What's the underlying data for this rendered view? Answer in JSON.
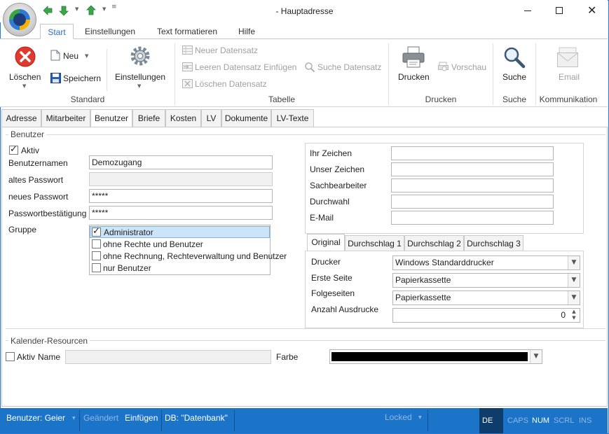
{
  "window": {
    "title": "- Hauptadresse"
  },
  "ribbon": {
    "tabs": [
      "Start",
      "Einstellungen",
      "Text formatieren",
      "Hilfe"
    ],
    "standard": {
      "group_label": "Standard",
      "delete_label": "Löschen",
      "new_label": "Neu",
      "save_label": "Speichern",
      "settings_label": "Einstellungen"
    },
    "tabelle": {
      "group_label": "Tabelle",
      "new_record": "Neuer Datensatz",
      "insert_empty": "Leeren Datensatz Einfügen",
      "search_record": "Suche Datensatz",
      "delete_record": "Löschen Datensatz"
    },
    "drucken": {
      "group_label": "Drucken",
      "print_label": "Drucken",
      "preview_label": "Vorschau"
    },
    "suche": {
      "group_label": "Suche",
      "search_label": "Suche"
    },
    "kommunikation": {
      "group_label": "Kommunikation",
      "email_label": "Email"
    }
  },
  "page_tabs": [
    "Adresse",
    "Mitarbeiter",
    "Benutzer",
    "Briefe",
    "Kosten",
    "LV",
    "Dokumente",
    "LV-Texte"
  ],
  "benutzer": {
    "group_title": "Benutzer",
    "aktiv_label": "Aktiv",
    "aktiv_checked": true,
    "username_label": "Benutzernamen",
    "username_value": "Demozugang",
    "old_pw_label": "altes Passwort",
    "old_pw_value": "",
    "new_pw_label": "neues Passwort",
    "new_pw_value": "*****",
    "confirm_pw_label": "Passwortbestätigung",
    "confirm_pw_value": "*****",
    "group_label": "Gruppe",
    "groups": [
      {
        "label": "Administrator",
        "checked": true
      },
      {
        "label": "ohne Rechte und Benutzer",
        "checked": false
      },
      {
        "label": "ohne Rechnung, Rechteverwaltung und Benutzer",
        "checked": false
      },
      {
        "label": "nur Benutzer",
        "checked": false
      }
    ]
  },
  "reference": {
    "ihr_zeichen": "Ihr Zeichen",
    "unser_zeichen": "Unser Zeichen",
    "sachbearbeiter": "Sachbearbeiter",
    "durchwahl": "Durchwahl",
    "email": "E-Mail"
  },
  "print_tabs": [
    "Original",
    "Durchschlag 1",
    "Durchschlag 2",
    "Durchschlag 3"
  ],
  "print": {
    "printer_label": "Drucker",
    "printer_value": "Windows Standarddrucker",
    "first_page_label": "Erste Seite",
    "first_page_value": "Papierkassette",
    "following_label": "Folgeseiten",
    "following_value": "Papierkassette",
    "copies_label": "Anzahl Ausdrucke",
    "copies_value": "0"
  },
  "kalender": {
    "group_title": "Kalender-Resourcen",
    "aktiv_label": "Aktiv",
    "name_label": "Name",
    "farbe_label": "Farbe",
    "color": "#000000"
  },
  "statusbar": {
    "user": "Benutzer: Geier",
    "changed": "Geändert",
    "insert": "Einfügen",
    "db": "DB: \"Datenbank\"",
    "locked": "Locked",
    "lang": "DE",
    "caps": "CAPS",
    "num": "NUM",
    "scrl": "SCRL",
    "ins": "INS"
  },
  "colors": {
    "accent": "#1b74c8",
    "selection": "#cce4f7"
  }
}
